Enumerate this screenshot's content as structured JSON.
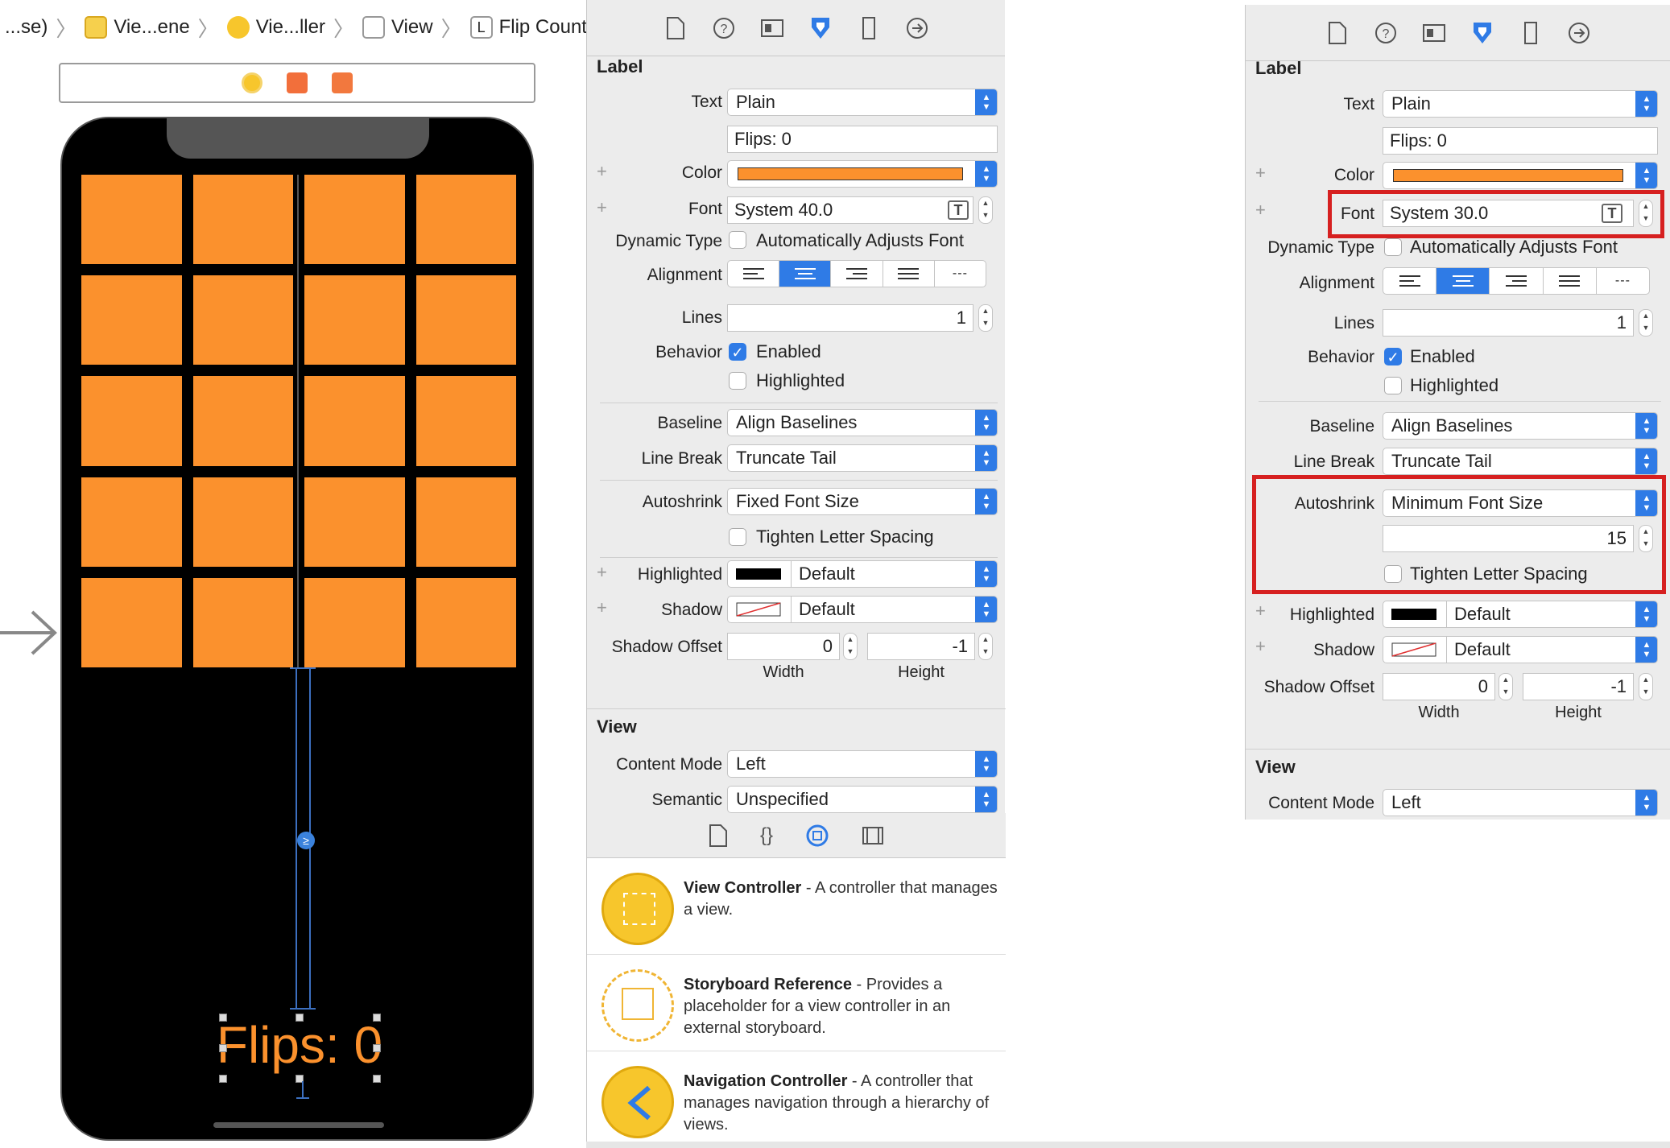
{
  "breadcrumb": [
    {
      "label": "...se)",
      "icon": "folder-icon"
    },
    {
      "label": "Vie...ene",
      "icon": "storyboard-scene-icon"
    },
    {
      "label": "Vie...ller",
      "icon": "view-controller-icon"
    },
    {
      "label": "View",
      "icon": "view-icon"
    },
    {
      "label": "Flip Count Label",
      "icon": "label-icon",
      "badge": "L"
    }
  ],
  "canvas": {
    "label_text": "Flips: 0",
    "card_color": "#fb912d",
    "constraint_badge": "≥"
  },
  "inspector_left": {
    "label_section": "Label",
    "text_label": "Text",
    "text_value": "Plain",
    "text_content": "Flips: 0",
    "color_label": "Color",
    "color_value": "#fb912d",
    "font_label": "Font",
    "font_value": "System 40.0",
    "dynamic_type_label": "Dynamic Type",
    "dynamic_type_option": "Automatically Adjusts Font",
    "alignment_label": "Alignment",
    "lines_label": "Lines",
    "lines_value": "1",
    "behavior_label": "Behavior",
    "enabled_label": "Enabled",
    "highlighted_label": "Highlighted",
    "baseline_label": "Baseline",
    "baseline_value": "Align Baselines",
    "line_break_label": "Line Break",
    "line_break_value": "Truncate Tail",
    "autoshrink_label": "Autoshrink",
    "autoshrink_value": "Fixed Font Size",
    "tighten_label": "Tighten Letter Spacing",
    "highlighted_color_label": "Highlighted",
    "highlighted_color_value": "Default",
    "shadow_label": "Shadow",
    "shadow_value": "Default",
    "shadow_offset_label": "Shadow Offset",
    "shadow_width": "0",
    "shadow_height": "-1",
    "width_label": "Width",
    "height_label": "Height",
    "view_section": "View",
    "content_mode_label": "Content Mode",
    "content_mode_value": "Left",
    "semantic_label": "Semantic",
    "semantic_value": "Unspecified"
  },
  "inspector_right": {
    "label_section": "Label",
    "text_label": "Text",
    "text_value": "Plain",
    "text_content": "Flips: 0",
    "color_label": "Color",
    "color_value": "#fb912d",
    "font_label": "Font",
    "font_value": "System 30.0",
    "dynamic_type_label": "Dynamic Type",
    "dynamic_type_option": "Automatically Adjusts Font",
    "alignment_label": "Alignment",
    "lines_label": "Lines",
    "lines_value": "1",
    "behavior_label": "Behavior",
    "enabled_label": "Enabled",
    "highlighted_label": "Highlighted",
    "baseline_label": "Baseline",
    "baseline_value": "Align Baselines",
    "line_break_label": "Line Break",
    "line_break_value": "Truncate Tail",
    "autoshrink_label": "Autoshrink",
    "autoshrink_value": "Minimum Font Size",
    "min_font_size": "15",
    "tighten_label": "Tighten Letter Spacing",
    "highlighted_color_label": "Highlighted",
    "highlighted_color_value": "Default",
    "shadow_label": "Shadow",
    "shadow_value": "Default",
    "shadow_offset_label": "Shadow Offset",
    "shadow_width": "0",
    "shadow_height": "-1",
    "width_label": "Width",
    "height_label": "Height",
    "view_section": "View",
    "content_mode_label": "Content Mode",
    "content_mode_value": "Left"
  },
  "library": [
    {
      "title": "View Controller",
      "desc": " - A controller that manages a view.",
      "icon": "view-controller-library-icon"
    },
    {
      "title": "Storyboard Reference",
      "desc": " - Provides a placeholder for a view controller in an external storyboard.",
      "icon": "storyboard-reference-library-icon"
    },
    {
      "title": "Navigation Controller",
      "desc": " - A controller that manages navigation through a hierarchy of views.",
      "icon": "navigation-controller-library-icon"
    }
  ],
  "colors": {
    "accent": "#2f7be6",
    "highlight_box": "#d62020",
    "orange": "#fb912d"
  }
}
